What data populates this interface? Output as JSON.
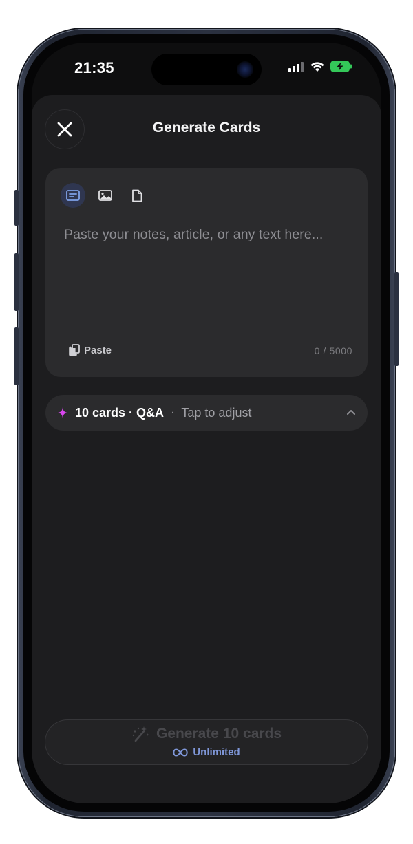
{
  "status_bar": {
    "time": "21:35"
  },
  "sheet": {
    "title": "Generate Cards"
  },
  "input": {
    "modes": [
      "text-mode",
      "image-mode",
      "document-mode"
    ],
    "placeholder": "Paste your notes, article, or any text here...",
    "paste_label": "Paste",
    "char_counter": "0 / 5000"
  },
  "settings": {
    "summary": "10 cards · Q&A",
    "separator": "·",
    "hint": "Tap to adjust"
  },
  "generate": {
    "label": "Generate 10 cards",
    "plan_label": "Unlimited"
  },
  "colors": {
    "sheet_bg": "#1d1d1f",
    "card_bg": "#2b2b2d",
    "accent_sparkle": "#d946ef",
    "unlimited_blue": "#7f97d9",
    "battery_green": "#34c759"
  },
  "icons": {
    "close": "close-icon",
    "text_mode": "text-lines-icon",
    "image_mode": "image-icon",
    "document_mode": "document-icon",
    "paste": "clipboard-icon",
    "sparkle": "sparkle-icon",
    "chevron": "chevron-up-icon",
    "generate": "magic-wand-icon",
    "unlimited": "infinity-icon"
  }
}
